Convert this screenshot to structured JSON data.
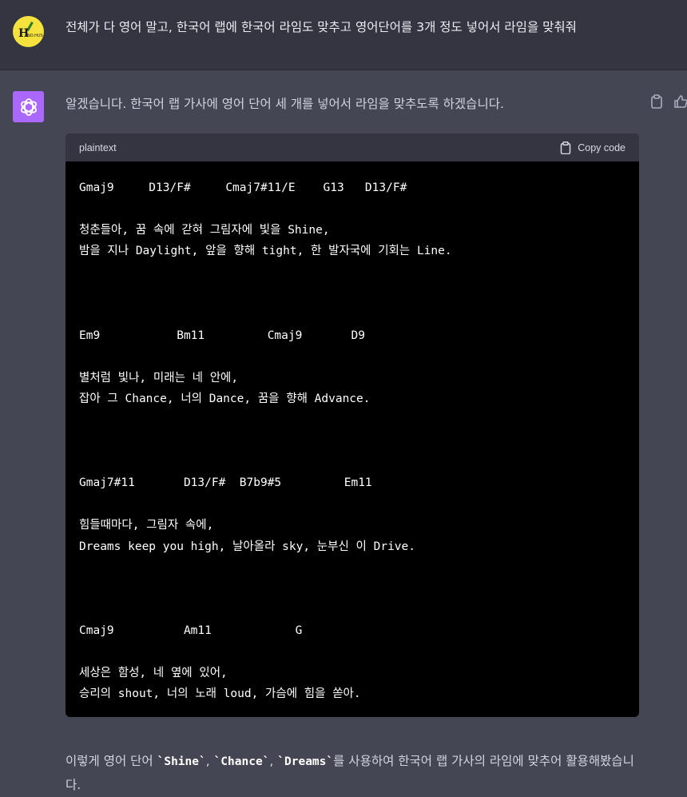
{
  "user": {
    "message": "전체가 다 영어 말고, 한국어 랩에 한국어 라임도 맞추고 영어단어를 3개 정도 넣어서 라임을 맞춰줘",
    "avatar_text": "H",
    "avatar_sub": "NO.HUS"
  },
  "assistant": {
    "intro": "알겠습니다. 한국어 랩 가사에 영어 단어 세 개를 넣어서 라임을 맞추도록 하겠습니다.",
    "code": {
      "language": "plaintext",
      "copy_label": "Copy code",
      "lines": [
        "Gmaj9     D13/F#     Cmaj7#11/E    G13   D13/F#",
        "",
        "청춘들아, 꿈 속에 갇혀 그림자에 빛을 Shine,",
        "밤을 지나 Daylight, 앞을 향해 tight, 한 발자국에 기회는 Line.",
        "",
        "",
        "",
        "Em9           Bm11         Cmaj9       D9",
        "",
        "별처럼 빛나, 미래는 네 안에,",
        "잡아 그 Chance, 너의 Dance, 꿈을 향해 Advance.",
        "",
        "",
        "",
        "Gmaj7#11       D13/F#  B7b9#5         Em11",
        "",
        "힘들때마다, 그림자 속에,",
        "Dreams keep you high, 날아올라 sky, 눈부신 이 Drive.",
        "",
        "",
        "",
        "Cmaj9          Am11            G",
        "",
        "세상은 함성, 네 옆에 있어,",
        "승리의 shout, 너의 노래 loud, 가슴에 힘을 쏟아."
      ]
    },
    "outro": {
      "prefix": "이렇게 영어 단어 ",
      "word1": "`Shine`",
      "sep1": ", ",
      "word2": "`Chance`",
      "sep2": ", ",
      "word3": "`Dreams`",
      "suffix": "를 사용하여 한국어 랩 가사의 라임에 맞추어 활용해봤습니다."
    }
  },
  "colors": {
    "user_bg": "#343541",
    "assistant_bg": "#444654",
    "gpt_avatar": "#ab68ff",
    "user_avatar": "#f5e23c"
  }
}
